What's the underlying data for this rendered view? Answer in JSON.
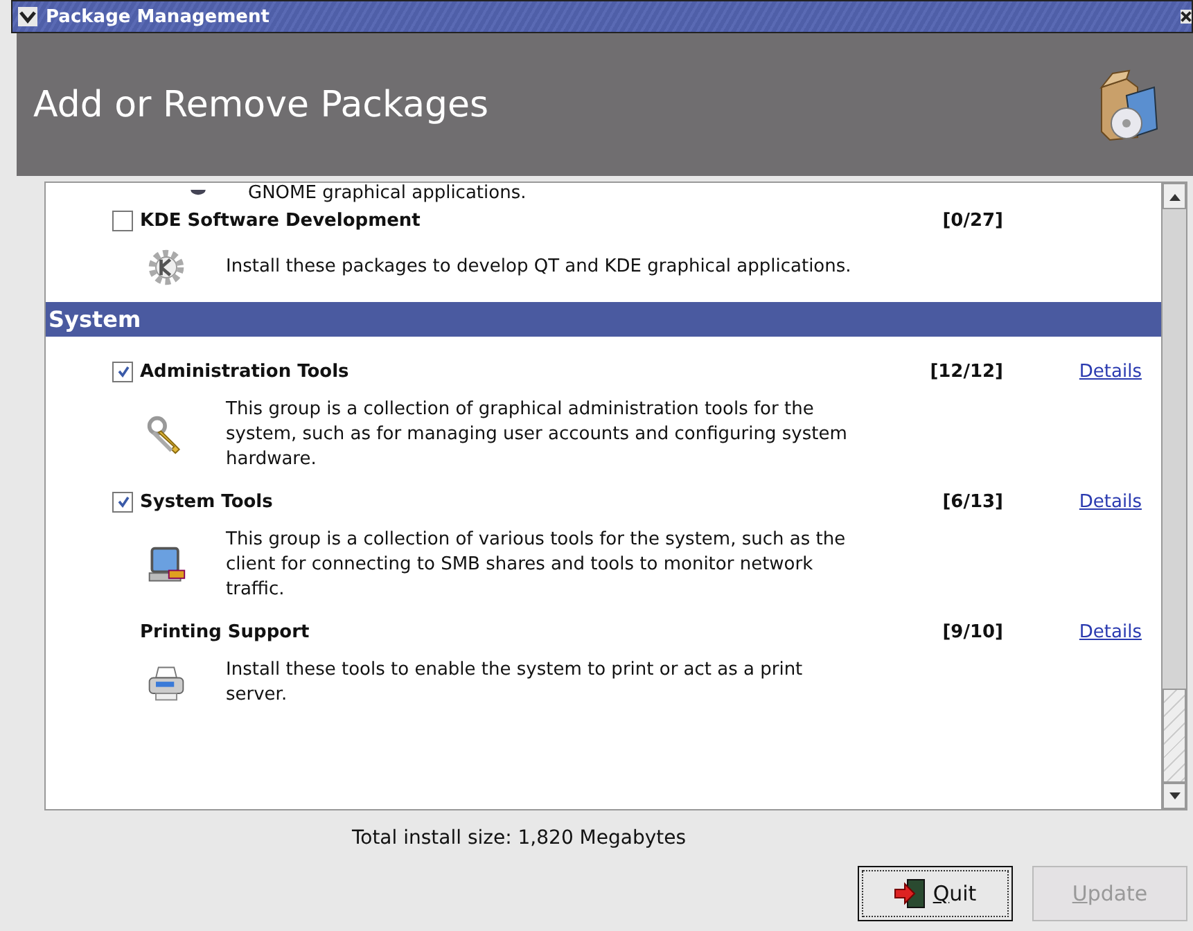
{
  "window": {
    "title": "Package Management"
  },
  "header": {
    "title": "Add or Remove Packages"
  },
  "partial_text": "GNOME graphical applications.",
  "sections": [
    {
      "items": [
        {
          "kind": "checkbox",
          "checked": false,
          "name": "KDE Software Development",
          "count": "[0/27]",
          "description": "Install these packages to develop QT and KDE graphical applications."
        }
      ]
    },
    {
      "heading": "System",
      "items": [
        {
          "kind": "checkbox",
          "checked": true,
          "name": "Administration Tools",
          "count": "[12/12]",
          "link": "Details",
          "description": "This group is a collection of graphical administration tools for the system, such as for managing user accounts and configuring system hardware."
        },
        {
          "kind": "checkbox",
          "checked": true,
          "name": "System Tools",
          "count": "[6/13]",
          "link": "Details",
          "description": "This group is a collection of various tools for the system, such as the client for connecting to SMB shares and tools to monitor network traffic."
        },
        {
          "kind": "plain",
          "name": "Printing Support",
          "count": "[9/10]",
          "link": "Details",
          "description": "Install these tools to enable the system to print or act as a print server."
        }
      ]
    }
  ],
  "total": "Total install size: 1,820 Megabytes",
  "buttons": [
    {
      "label": "Quit",
      "kind": "quit",
      "disabled": false
    },
    {
      "label": "Update",
      "kind": "plain",
      "disabled": true
    }
  ]
}
